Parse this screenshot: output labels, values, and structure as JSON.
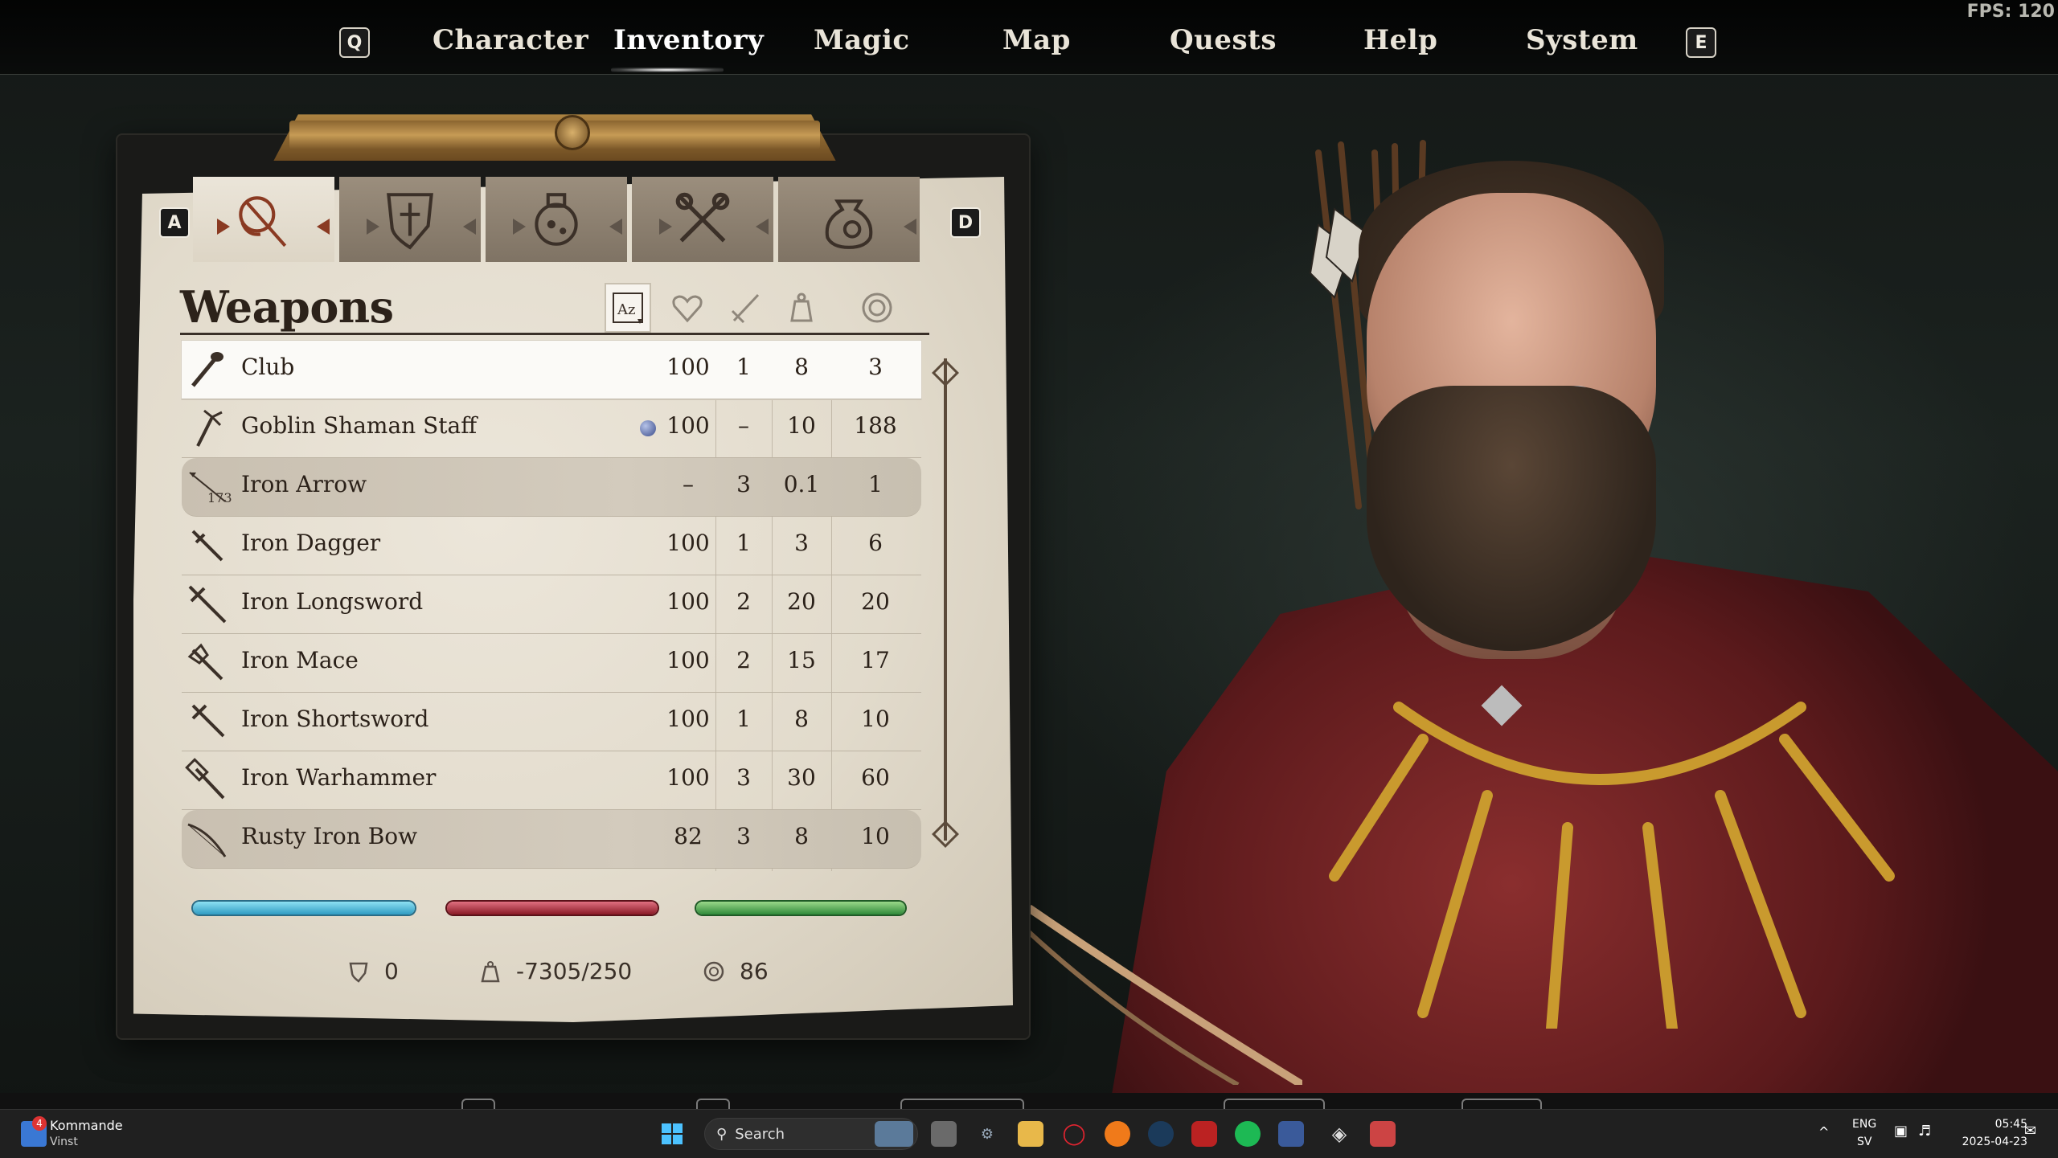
{
  "fps": "FPS: 120",
  "nav": {
    "left_key": "Q",
    "right_key": "E",
    "items": [
      "Character",
      "Inventory",
      "Magic",
      "Map",
      "Quests",
      "Help",
      "System"
    ],
    "active": "Inventory"
  },
  "inventory": {
    "tab_left_key": "A",
    "tab_right_key": "D",
    "tabs": [
      "weapons-tab",
      "armor-tab",
      "alchemy-tab",
      "misc-tab",
      "ingredients-tab"
    ],
    "active_tab": "weapons-tab",
    "title": "Weapons",
    "sort_columns": [
      "sort-name-icon",
      "sort-health-icon",
      "sort-damage-icon",
      "sort-weight-icon",
      "sort-value-icon"
    ],
    "items": [
      {
        "name": "Club",
        "condition": "100",
        "damage": "1",
        "weight": "8",
        "value": "3",
        "selected": true
      },
      {
        "name": "Goblin Shaman Staff",
        "condition": "100",
        "damage": "–",
        "weight": "10",
        "value": "188",
        "enchanted": true
      },
      {
        "name": "Iron Arrow",
        "condition": "–",
        "damage": "3",
        "weight": "0.1",
        "value": "1",
        "quantity": "173",
        "equipped": true
      },
      {
        "name": "Iron Dagger",
        "condition": "100",
        "damage": "1",
        "weight": "3",
        "value": "6"
      },
      {
        "name": "Iron Longsword",
        "condition": "100",
        "damage": "2",
        "weight": "20",
        "value": "20"
      },
      {
        "name": "Iron Mace",
        "condition": "100",
        "damage": "2",
        "weight": "15",
        "value": "17"
      },
      {
        "name": "Iron Shortsword",
        "condition": "100",
        "damage": "1",
        "weight": "8",
        "value": "10"
      },
      {
        "name": "Iron Warhammer",
        "condition": "100",
        "damage": "3",
        "weight": "30",
        "value": "60"
      },
      {
        "name": "Rusty Iron Bow",
        "condition": "82",
        "damage": "3",
        "weight": "8",
        "value": "10",
        "equipped": true
      }
    ],
    "bars": {
      "magicka": 1.0,
      "health": 1.0,
      "fatigue": 1.0
    },
    "footer": {
      "armor": "0",
      "encumbrance": "-7305/250",
      "gold": "86"
    }
  },
  "taskbar": {
    "widget_badge": "4",
    "widget_title": "Kommande",
    "widget_subtitle": "Vinst",
    "search_label": "Search",
    "lang_top": "ENG",
    "lang_bottom": "SV",
    "time": "05:45",
    "date": "2025-04-23"
  },
  "colors": {
    "parchment": "#e6e0d3",
    "ink": "#2b2119",
    "magicka_bar": "#2f9cc2",
    "health_bar": "#8a1a26",
    "fatigue_bar": "#2f8a3a",
    "cape": "#7a2226"
  }
}
